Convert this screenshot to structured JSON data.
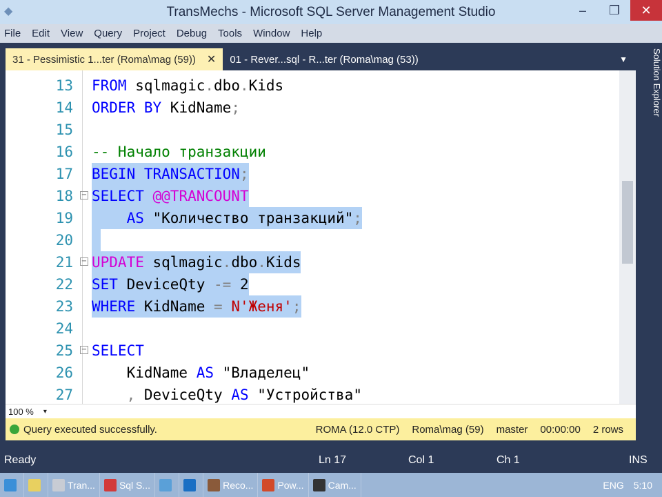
{
  "window": {
    "title": "TransMechs - Microsoft SQL Server Management Studio",
    "minimize": "–",
    "maximize": "❐",
    "close": "✕"
  },
  "menu": [
    "File",
    "Edit",
    "View",
    "Query",
    "Project",
    "Debug",
    "Tools",
    "Window",
    "Help"
  ],
  "tabs": [
    {
      "label": "31 - Pessimistic 1...ter (Roma\\mag (59))",
      "close": "✕",
      "active": true
    },
    {
      "label": "01 - Rever...sql - R...ter (Roma\\mag (53))",
      "active": false
    }
  ],
  "side_panel": "Solution Explorer",
  "editor": {
    "lines": [
      {
        "n": "13",
        "sel": false,
        "fold": false,
        "tokens": [
          [
            "FROM",
            "k"
          ],
          [
            " sqlmagic",
            "p"
          ],
          [
            ".",
            "g"
          ],
          [
            "dbo",
            "p"
          ],
          [
            ".",
            "g"
          ],
          [
            "Kids",
            "p"
          ]
        ]
      },
      {
        "n": "14",
        "sel": false,
        "fold": false,
        "tokens": [
          [
            "ORDER BY",
            "k"
          ],
          [
            " KidName",
            "p"
          ],
          [
            ";",
            "g"
          ]
        ]
      },
      {
        "n": "15",
        "sel": false,
        "fold": false,
        "tokens": []
      },
      {
        "n": "16",
        "sel": false,
        "fold": false,
        "tokens": [
          [
            "-- Начало транзакции",
            "cm"
          ]
        ]
      },
      {
        "n": "17",
        "sel": true,
        "fold": false,
        "tokens": [
          [
            "BEGIN TRANSACTION",
            "k"
          ],
          [
            ";",
            "g"
          ]
        ]
      },
      {
        "n": "18",
        "sel": true,
        "fold": true,
        "tokens": [
          [
            "SELECT",
            "k"
          ],
          [
            " ",
            "p"
          ],
          [
            "@@TRANCOUNT",
            "m"
          ]
        ]
      },
      {
        "n": "19",
        "sel": true,
        "fold": false,
        "tokens": [
          [
            "    AS",
            "k"
          ],
          [
            " \"Количество транзакций\"",
            "p"
          ],
          [
            ";",
            "g"
          ]
        ]
      },
      {
        "n": "20",
        "sel": true,
        "fold": false,
        "tokens": [
          [
            " ",
            "p"
          ]
        ]
      },
      {
        "n": "21",
        "sel": true,
        "fold": true,
        "tokens": [
          [
            "UPDATE",
            "m"
          ],
          [
            " sqlmagic",
            "p"
          ],
          [
            ".",
            "g"
          ],
          [
            "dbo",
            "p"
          ],
          [
            ".",
            "g"
          ],
          [
            "Kids",
            "p"
          ]
        ]
      },
      {
        "n": "22",
        "sel": true,
        "fold": false,
        "tokens": [
          [
            "SET",
            "k"
          ],
          [
            " DeviceQty ",
            "p"
          ],
          [
            "-=",
            "g"
          ],
          [
            " 2",
            "p"
          ]
        ]
      },
      {
        "n": "23",
        "sel": true,
        "fold": false,
        "tokens": [
          [
            "WHERE",
            "k"
          ],
          [
            " KidName ",
            "p"
          ],
          [
            "=",
            "g"
          ],
          [
            " ",
            "p"
          ],
          [
            "N'Женя'",
            "s"
          ],
          [
            ";",
            "g"
          ]
        ]
      },
      {
        "n": "24",
        "sel": false,
        "fold": false,
        "tokens": []
      },
      {
        "n": "25",
        "sel": false,
        "fold": true,
        "tokens": [
          [
            "SELECT",
            "k"
          ]
        ]
      },
      {
        "n": "26",
        "sel": false,
        "fold": false,
        "tokens": [
          [
            "    KidName ",
            "p"
          ],
          [
            "AS",
            "k"
          ],
          [
            " \"Владелец\"",
            "p"
          ]
        ]
      },
      {
        "n": "27",
        "sel": false,
        "fold": false,
        "tokens": [
          [
            "    ",
            "p"
          ],
          [
            ",",
            "g"
          ],
          [
            " DeviceQty ",
            "p"
          ],
          [
            "AS",
            "k"
          ],
          [
            " \"Устройства\"",
            "p"
          ]
        ]
      }
    ]
  },
  "zoom": {
    "value": "100 %",
    "arrow": "▾"
  },
  "query_status": {
    "message": "Query executed successfully.",
    "server": "ROMA (12.0 CTP)",
    "user": "Roma\\mag (59)",
    "database": "master",
    "time": "00:00:00",
    "rows": "2 rows"
  },
  "statusbar": {
    "state": "Ready",
    "ln": "Ln 17",
    "col": "Col 1",
    "ch": "Ch 1",
    "mode": "INS"
  },
  "taskbar": {
    "items": [
      {
        "label": "",
        "color": "#3a8fd8"
      },
      {
        "label": "",
        "color": "#e8d060"
      },
      {
        "label": "Tran...",
        "color": "#c8ccd4"
      },
      {
        "label": "Sql S...",
        "color": "#d23a3a"
      },
      {
        "label": "",
        "color": "#5aa0d8"
      },
      {
        "label": "",
        "color": "#1a6fc4"
      },
      {
        "label": "Reco...",
        "color": "#8a5a3a"
      },
      {
        "label": "Pow...",
        "color": "#d24a2a"
      },
      {
        "label": "Cam...",
        "color": "#333"
      }
    ],
    "tray": [
      "ENG",
      "5:10"
    ]
  }
}
